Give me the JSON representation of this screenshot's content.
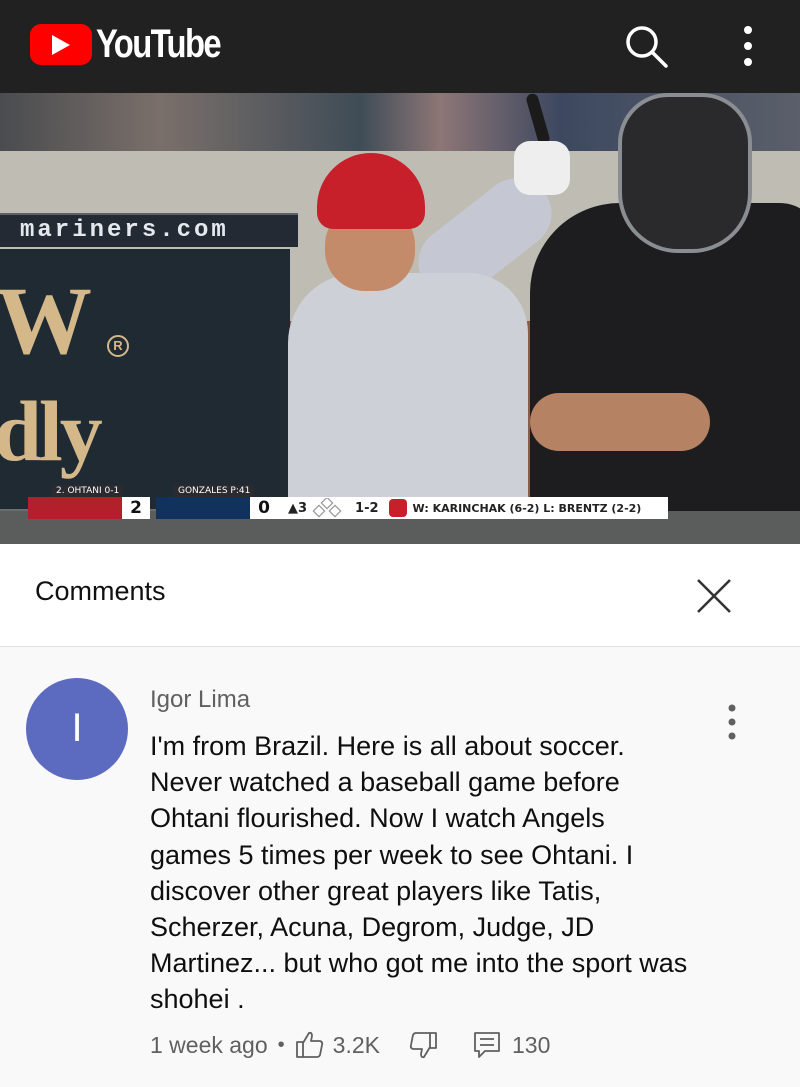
{
  "topbar": {
    "logo_text": "YouTube",
    "icons": [
      "youtube-play-icon",
      "search-icon",
      "more-vert-icon"
    ],
    "colors": {
      "bar": "#212121",
      "logo_red": "#ff0000"
    }
  },
  "video": {
    "sign_text": "mariners.com",
    "ad_text_1": "W",
    "ad_text_2": "dly",
    "registered_mark": "R",
    "scorebug": {
      "team1_label": "2. OHTANI 0-1",
      "team1_score": "2",
      "team2_label": "GONZALES P:41",
      "team2_score": "0",
      "inning": "▲3",
      "count": "1-2",
      "pitchers": "W: KARINCHAK (6-2)  L: BRENTZ (2-2)",
      "colors": {
        "team1": "#b31f2a",
        "team2": "#10325d"
      }
    }
  },
  "comments_panel": {
    "title": "Comments",
    "close_icon": "close-icon"
  },
  "comment": {
    "avatar_letter": "I",
    "avatar_color": "#5c6bc0",
    "author": "Igor Lima",
    "text": "I'm from Brazil. Here is all about soccer. Never watched a baseball game before Ohtani flourished. Now I watch Angels games 5 times per week to see Ohtani. I discover other great players like Tatis, Scherzer, Acuna, Degrom, Judge, JD Martinez... but who got me into the sport was shohei .",
    "time": "1 week ago",
    "separator": "•",
    "likes": "3.2K",
    "replies": "130"
  }
}
